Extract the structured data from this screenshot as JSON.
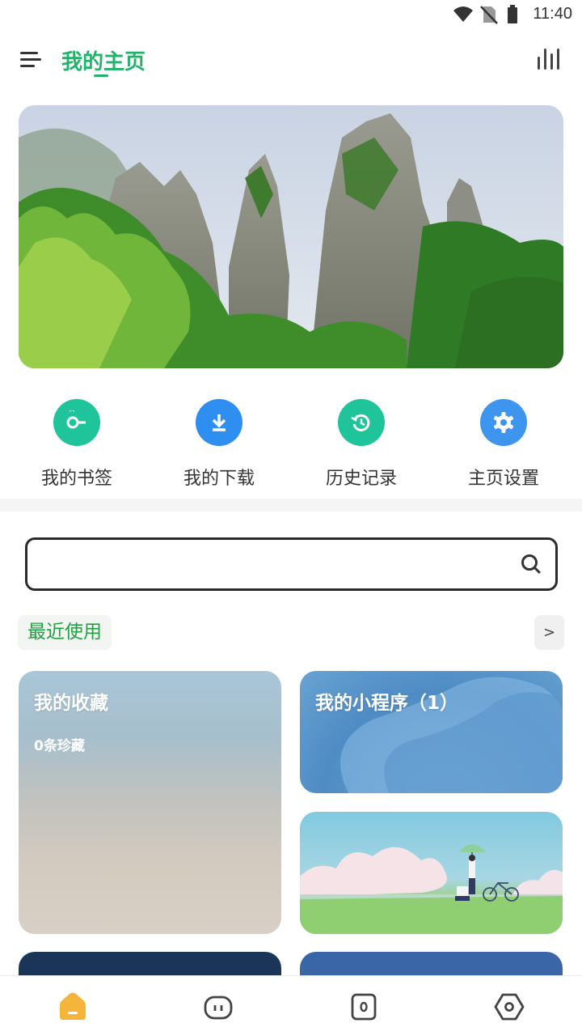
{
  "status_bar": {
    "time": "11:40"
  },
  "header": {
    "title": "我的主页"
  },
  "quick_actions": [
    {
      "label": "我的书签",
      "icon": "bookmark-key-icon",
      "color": "#1fc49a"
    },
    {
      "label": "我的下载",
      "icon": "download-icon",
      "color": "#2f8ff0"
    },
    {
      "label": "历史记录",
      "icon": "history-icon",
      "color": "#1fc49a"
    },
    {
      "label": "主页设置",
      "icon": "gear-icon",
      "color": "#3d95ee"
    }
  ],
  "search": {
    "value": "",
    "placeholder": ""
  },
  "recent": {
    "label": "最近使用",
    "more": ">"
  },
  "cards": {
    "favorites": {
      "title": "我的收藏",
      "subtitle": "0条珍藏"
    },
    "mini_programs": {
      "title": "我的小程序（1）"
    }
  },
  "colors": {
    "accent": "#21b36b",
    "section_green": "#21a142"
  }
}
